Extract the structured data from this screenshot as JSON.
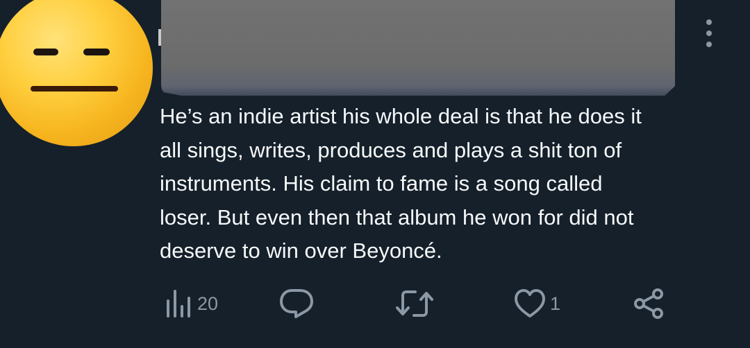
{
  "tweet": {
    "text": "He’s an indie artist his whole deal is that he does it\nall sings, writes, produces  and plays a shit ton of\ninstruments. His claim to fame is a song called\nloser. But even then that album he won for did not\ndeserve to win over Beyoncé."
  },
  "actions": {
    "views": {
      "icon": "views-icon",
      "count": "20"
    },
    "reply": {
      "icon": "reply-icon"
    },
    "retweet": {
      "icon": "retweet-icon"
    },
    "like": {
      "icon": "heart-icon",
      "count": "1"
    },
    "share": {
      "icon": "share-icon"
    }
  },
  "colors": {
    "background": "#15202b",
    "text": "#f7f9f9",
    "muted": "#8b98a5"
  }
}
